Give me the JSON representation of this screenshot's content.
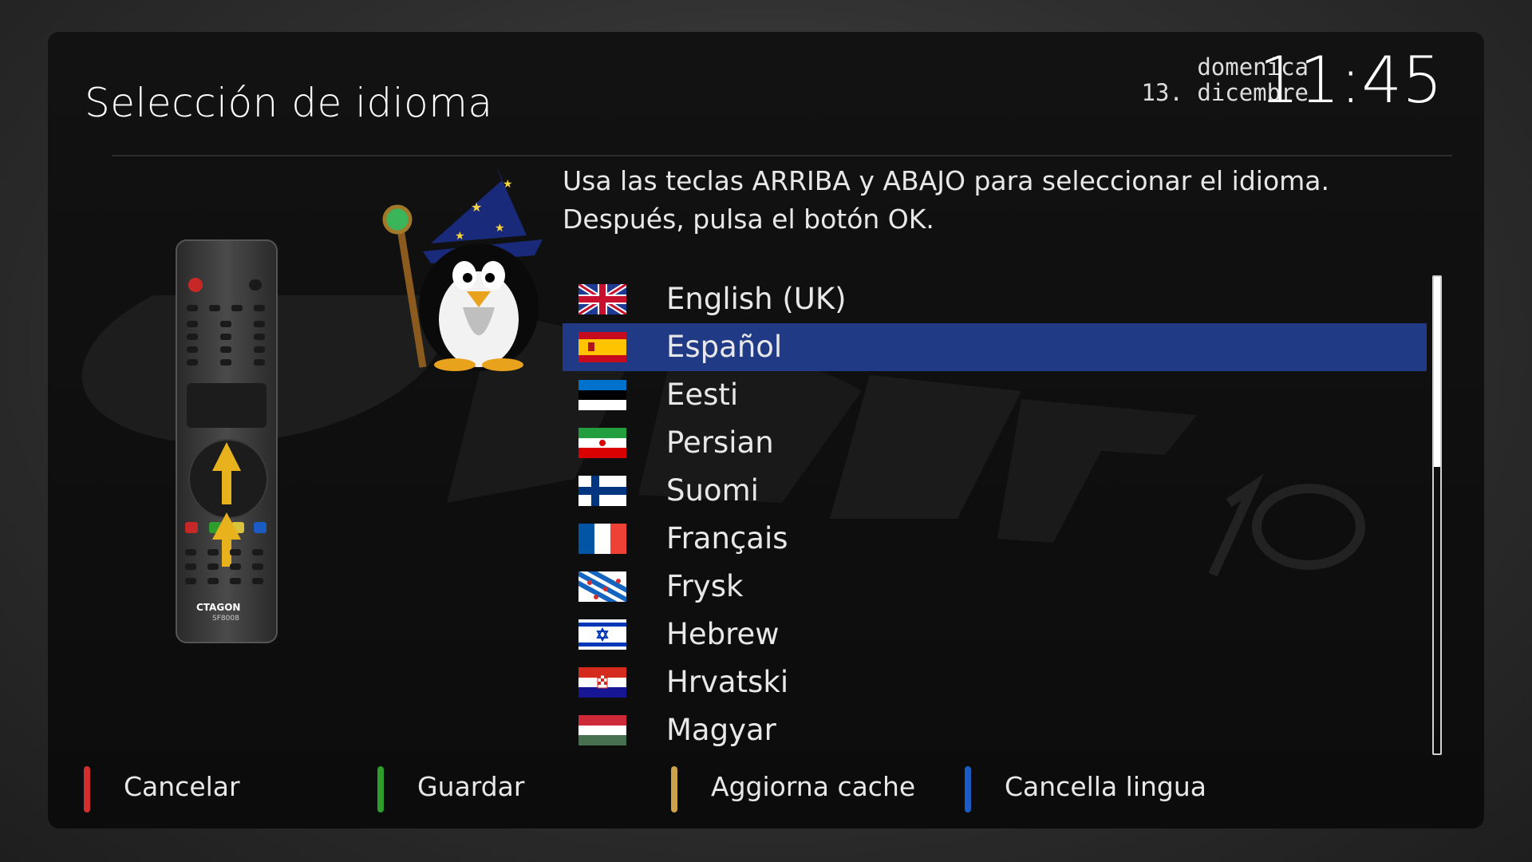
{
  "header": {
    "title": "Selección de idioma",
    "day": "domenica",
    "date": "13. dicembre",
    "time": "11:45"
  },
  "instructions": "Usa las teclas ARRIBA y ABAJO para seleccionar el idioma. Después, pulsa el botón OK.",
  "languages": [
    {
      "label": "English (UK)",
      "flag": "uk-flag-icon"
    },
    {
      "label": "Español",
      "flag": "spain-flag-icon",
      "selected": true
    },
    {
      "label": "Eesti",
      "flag": "estonia-flag-icon"
    },
    {
      "label": "Persian",
      "flag": "iran-flag-icon"
    },
    {
      "label": "Suomi",
      "flag": "finland-flag-icon"
    },
    {
      "label": "Français",
      "flag": "france-flag-icon"
    },
    {
      "label": "Frysk",
      "flag": "friesland-flag-icon"
    },
    {
      "label": "Hebrew",
      "flag": "israel-flag-icon"
    },
    {
      "label": "Hrvatski",
      "flag": "croatia-flag-icon"
    },
    {
      "label": "Magyar",
      "flag": "hungary-flag-icon"
    }
  ],
  "footer": {
    "red_label": "Cancelar",
    "green_label": "Guardar",
    "yellow_label": "Aggiorna cache",
    "blue_label": "Cancella lingua"
  },
  "remote": {
    "brand": "CTAGON",
    "model": "SF8008"
  },
  "colors": {
    "selection": "#213a86",
    "red": "#d32f2f",
    "green": "#2e9d2e",
    "yellow": "#c9a24a",
    "blue": "#1a5bc4"
  }
}
